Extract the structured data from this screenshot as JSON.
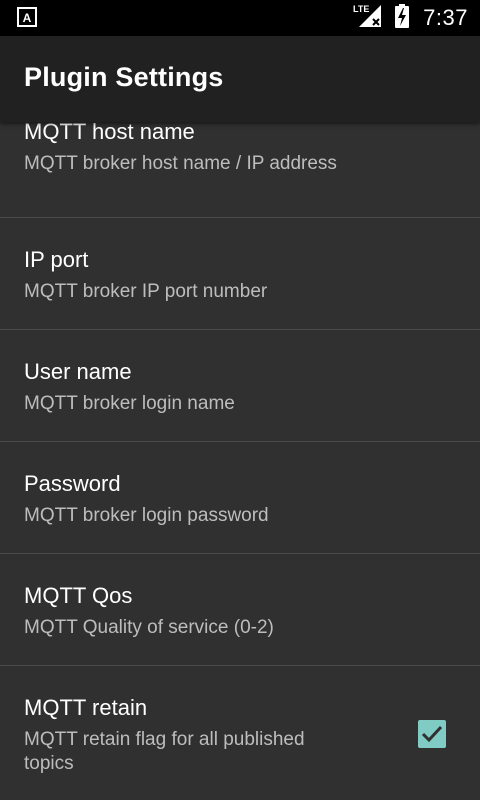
{
  "status_bar": {
    "time": "7:37",
    "network_label": "LTE",
    "icons": [
      "notification-a-icon",
      "signal-icon",
      "battery-charging-icon"
    ]
  },
  "app_bar": {
    "title": "Plugin Settings"
  },
  "preferences": [
    {
      "title": "MQTT host name",
      "summary": "MQTT broker host name / IP address"
    },
    {
      "title": "IP port",
      "summary": "MQTT broker IP port number"
    },
    {
      "title": "User name",
      "summary": "MQTT broker login name"
    },
    {
      "title": "Password",
      "summary": "MQTT broker login password"
    },
    {
      "title": "MQTT Qos",
      "summary": "MQTT Quality of service (0-2)"
    },
    {
      "title": "MQTT retain",
      "summary": "MQTT retain flag for all published topics",
      "checked": true
    }
  ],
  "colors": {
    "background": "#303030",
    "app_bar": "#212121",
    "accent": "#80cbc4",
    "divider": "#4a4a4a"
  }
}
